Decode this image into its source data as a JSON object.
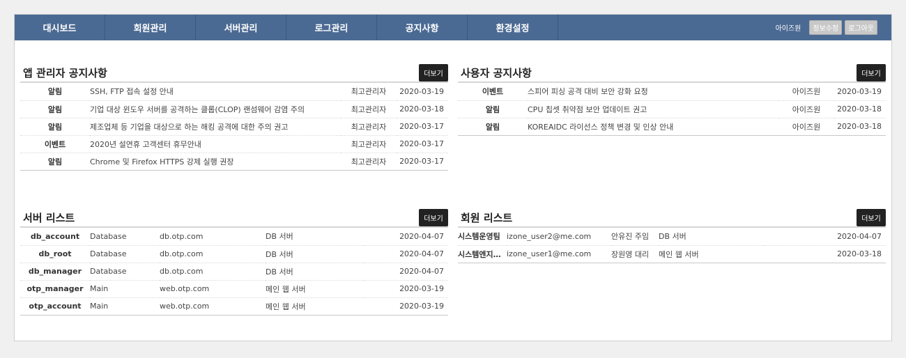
{
  "nav": {
    "items": [
      "대시보드",
      "회원관리",
      "서버관리",
      "로그관리",
      "공지사항",
      "환경설정"
    ],
    "user_name": "아이즈원",
    "edit_label": "정보수정",
    "logout_label": "로그아웃"
  },
  "admin_notices": {
    "title": "앱 관리자 공지사항",
    "more_label": "더보기",
    "rows": [
      {
        "type": "알림",
        "subject": "SSH, FTP 접속 설정 안내",
        "author": "최고관리자",
        "date": "2020-03-19"
      },
      {
        "type": "알림",
        "subject": "기업 대상 윈도우 서버를 공격하는 클롭(CLOP) 랜섬웨어 감염 주의",
        "author": "최고관리자",
        "date": "2020-03-18"
      },
      {
        "type": "알림",
        "subject": "제조업체 등 기업을 대상으로 하는 해킹 공격에 대한 주의 권고",
        "author": "최고관리자",
        "date": "2020-03-17"
      },
      {
        "type": "이벤트",
        "subject": "2020년 설연휴 고객센터 휴무안내",
        "author": "최고관리자",
        "date": "2020-03-17"
      },
      {
        "type": "알림",
        "subject": "Chrome 및 Firefox HTTPS 강제 실행 권장",
        "author": "최고관리자",
        "date": "2020-03-17"
      }
    ]
  },
  "user_notices": {
    "title": "사용자 공지사항",
    "more_label": "더보기",
    "rows": [
      {
        "type": "이벤트",
        "subject": "스피어 피싱 공격 대비 보안 강화 요청",
        "author": "아이즈원",
        "date": "2020-03-19"
      },
      {
        "type": "알림",
        "subject": "CPU 칩셋 취약점 보안 업데이트 권고",
        "author": "아이즈원",
        "date": "2020-03-18"
      },
      {
        "type": "알림",
        "subject": "KOREAIDC 라이선스 정책 변경 및 인상 안내",
        "author": "아이즈원",
        "date": "2020-03-18"
      }
    ]
  },
  "servers": {
    "title": "서버 리스트",
    "more_label": "더보기",
    "rows": [
      {
        "name": "db_account",
        "group": "Database",
        "host": "db.otp.com",
        "desc": "DB 서버",
        "date": "2020-04-07"
      },
      {
        "name": "db_root",
        "group": "Database",
        "host": "db.otp.com",
        "desc": "DB 서버",
        "date": "2020-04-07"
      },
      {
        "name": "db_manager",
        "group": "Database",
        "host": "db.otp.com",
        "desc": "DB 서버",
        "date": "2020-04-07"
      },
      {
        "name": "otp_manager",
        "group": "Main",
        "host": "web.otp.com",
        "desc": "메인 웹 서버",
        "date": "2020-03-19"
      },
      {
        "name": "otp_account",
        "group": "Main",
        "host": "web.otp.com",
        "desc": "메인 웹 서버",
        "date": "2020-03-19"
      }
    ]
  },
  "members": {
    "title": "회원 리스트",
    "more_label": "더보기",
    "rows": [
      {
        "team": "시스템운영팀",
        "email": "izone_user2@me.com",
        "name": "안유진 주임",
        "role": "DB 서버",
        "date": "2020-04-07"
      },
      {
        "team": "시스템엔지…",
        "email": "izone_user1@me.com",
        "name": "장원영 대리",
        "role": "메인 웹 서버",
        "date": "2020-03-18"
      }
    ]
  }
}
